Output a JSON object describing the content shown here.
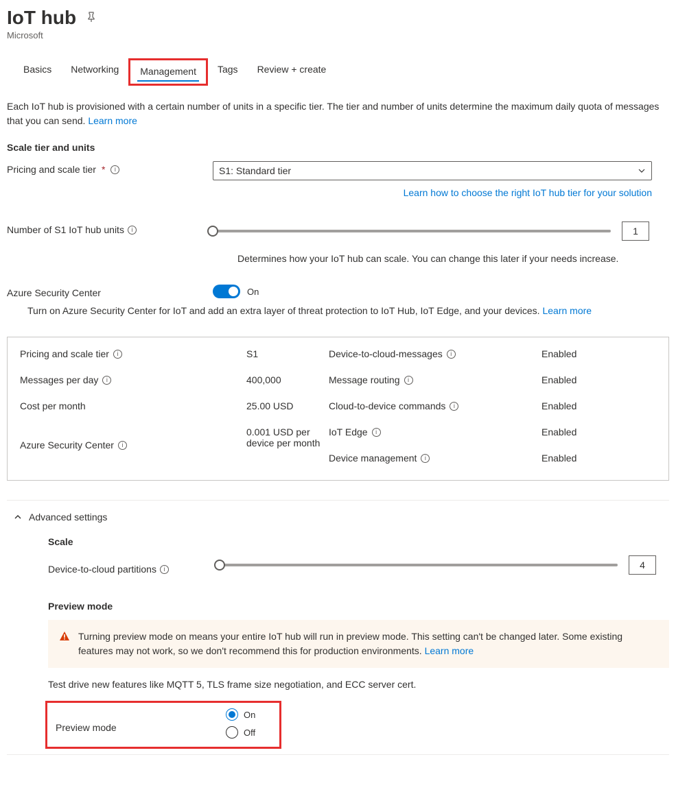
{
  "header": {
    "title": "IoT hub",
    "subtitle": "Microsoft"
  },
  "tabs": [
    "Basics",
    "Networking",
    "Management",
    "Tags",
    "Review + create"
  ],
  "active_tab_index": 2,
  "intro": {
    "text": "Each IoT hub is provisioned with a certain number of units in a specific tier. The tier and number of units determine the maximum daily quota of messages that you can send.",
    "learn_more": "Learn more"
  },
  "scale": {
    "section_title": "Scale tier and units",
    "pricing_label": "Pricing and scale tier",
    "pricing_value": "S1: Standard tier",
    "pricing_help_link": "Learn how to choose the right IoT hub tier for your solution",
    "units_label": "Number of S1 IoT hub units",
    "units_value": "1",
    "units_caption": "Determines how your IoT hub can scale. You can change this later if your needs increase."
  },
  "asc": {
    "label": "Azure Security Center",
    "state": "On",
    "desc": "Turn on Azure Security Center for IoT and add an extra layer of threat protection to IoT Hub, IoT Edge, and your devices.",
    "learn_more": "Learn more"
  },
  "summary": {
    "left": [
      {
        "label": "Pricing and scale tier",
        "value": "S1",
        "info": true
      },
      {
        "label": "Messages per day",
        "value": "400,000",
        "info": true
      },
      {
        "label": "Cost per month",
        "value": "25.00 USD",
        "info": false
      },
      {
        "label": "Azure Security Center",
        "value": "0.001 USD per device per month",
        "info": true
      }
    ],
    "right": [
      {
        "label": "Device-to-cloud-messages",
        "value": "Enabled"
      },
      {
        "label": "Message routing",
        "value": "Enabled"
      },
      {
        "label": "Cloud-to-device commands",
        "value": "Enabled"
      },
      {
        "label": "IoT Edge",
        "value": "Enabled"
      },
      {
        "label": "Device management",
        "value": "Enabled"
      }
    ]
  },
  "advanced": {
    "header": "Advanced settings",
    "scale_title": "Scale",
    "partitions_label": "Device-to-cloud partitions",
    "partitions_value": "4",
    "preview_title": "Preview mode",
    "warn_text": "Turning preview mode on means your entire IoT hub will run in preview mode. This setting can't be changed later. Some existing features may not work, so we don't recommend this for production environments.",
    "warn_learn_more": "Learn more",
    "preview_desc": "Test drive new features like MQTT 5, TLS frame size negotiation, and ECC server cert.",
    "preview_label": "Preview mode",
    "on": "On",
    "off": "Off"
  }
}
